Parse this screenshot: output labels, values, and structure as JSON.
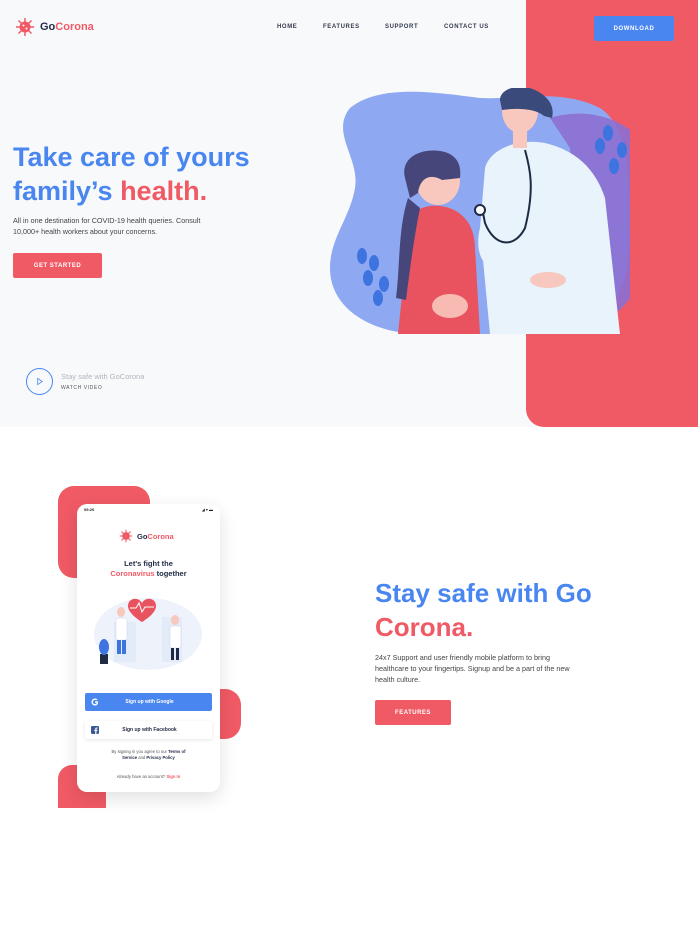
{
  "brand": {
    "name_part1": "Go",
    "name_part2": "Corona"
  },
  "nav": {
    "home": "HOME",
    "features": "FEATURES",
    "support": "SUPPORT",
    "contact": "CONTACT US"
  },
  "header": {
    "download_label": "DOWNLOAD"
  },
  "hero": {
    "title_line1": "Take care of yours",
    "title_line2_part1": "family’s ",
    "title_line2_part2": "health.",
    "subtitle_line1": "All in one destination for COVID-19 health queries.  Consult",
    "subtitle_line2": "10,000+ health workers about your concerns.",
    "cta_label": "GET STARTED",
    "video_title": "Stay safe with GoCorona",
    "video_label": "WATCH VIDEO"
  },
  "section2": {
    "title_line1": "Stay safe with Go",
    "title_line2": "Corona.",
    "subtitle_line1": "24x7 Support and user friendly mobile platform to bring",
    "subtitle_line2": "healthcare to your fingertips. Signup and be a part of the new",
    "subtitle_line3": "health culture.",
    "cta_label": "FEATURES"
  },
  "phone": {
    "time": "09:20",
    "brand_part1": "Go",
    "brand_part2": "Corona",
    "heading_line1": "Let's fight the",
    "heading_line2_part1": "Coronavirus",
    "heading_line2_part2": " together",
    "google_label": "Sign up with Google",
    "facebook_label": "Sign up with Facebook",
    "terms_part1": "By signing in you agree to our ",
    "terms_link1": "Terms of",
    "terms_link1b": "Service",
    "terms_part2": " and ",
    "terms_link2": "Privacy Policy",
    "account_text": "Already have an account? ",
    "signin_label": "Sign In"
  },
  "colors": {
    "primary_blue": "#4a86f0",
    "accent_red": "#f05a65",
    "dark": "#1f2a44"
  },
  "icons": [
    "virus-logo-icon",
    "play-icon",
    "google-icon",
    "facebook-icon",
    "heart-icon"
  ]
}
